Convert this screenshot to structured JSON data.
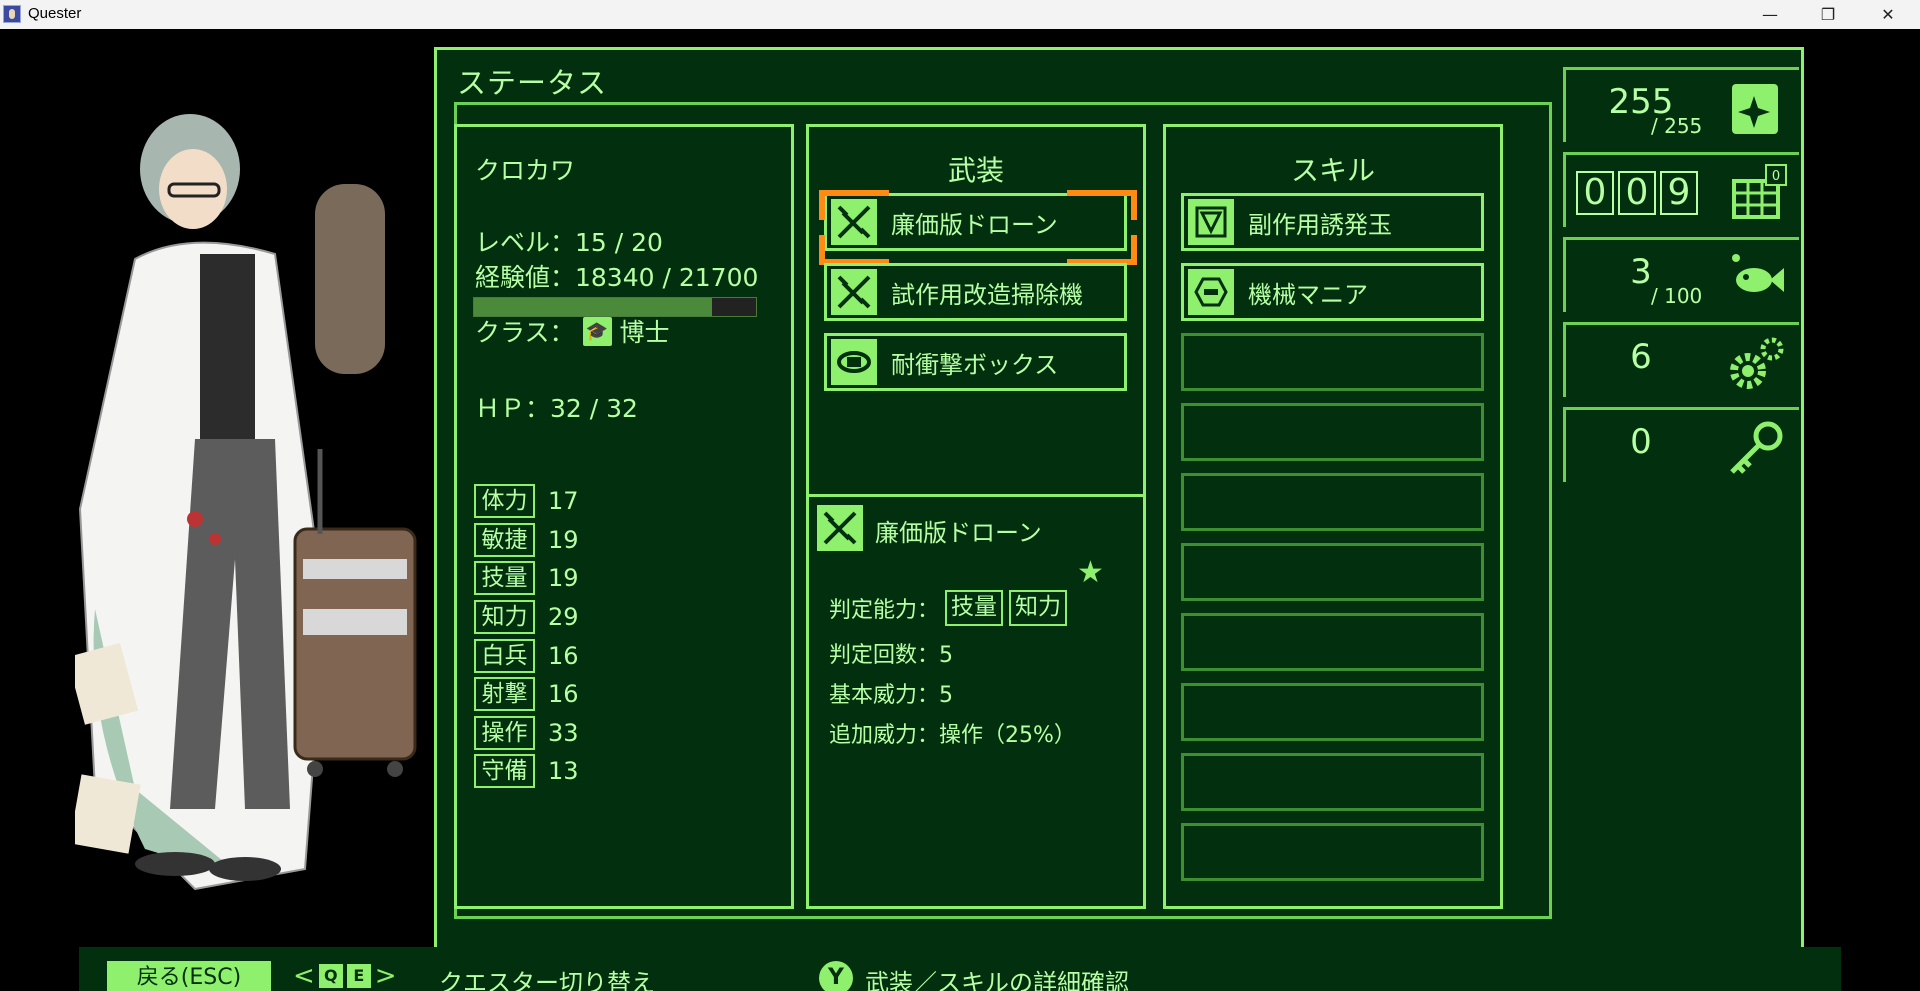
{
  "window": {
    "title": "Quester",
    "minimize": "—",
    "maximize": "❐",
    "close": "✕"
  },
  "panel": {
    "title": "ステータス"
  },
  "character": {
    "name": "クロカワ",
    "level_text": "レベル：15 / 20",
    "exp_text": "経験値：18340 / 21700",
    "exp_fraction": 0.845,
    "class_text": "クラス：",
    "class_name": "博士",
    "hp_text": "ＨＰ：32 / 32",
    "stats": [
      {
        "label": "体力",
        "value": "17"
      },
      {
        "label": "敏捷",
        "value": "19"
      },
      {
        "label": "技量",
        "value": "19"
      },
      {
        "label": "知力",
        "value": "29"
      },
      {
        "label": "白兵",
        "value": "16"
      },
      {
        "label": "射撃",
        "value": "16"
      },
      {
        "label": "操作",
        "value": "33"
      },
      {
        "label": "守備",
        "value": "13"
      }
    ]
  },
  "equipment": {
    "title": "武装",
    "items": [
      {
        "label": "廉価版ドローン",
        "icon": "drone-icon"
      },
      {
        "label": "試作用改造掃除機",
        "icon": "drone-icon"
      },
      {
        "label": "耐衝撃ボックス",
        "icon": "box-icon"
      }
    ],
    "detail": {
      "name": "廉価版ドローン",
      "star": "★",
      "judge_label": "判定能力：",
      "judge_tags": [
        "技量",
        "知力"
      ],
      "count_text": "判定回数：5",
      "power_text": "基本威力：5",
      "extra_text": "追加威力：操作（25%）"
    }
  },
  "skills": {
    "title": "スキル",
    "items": [
      {
        "label": "副作用誘発玉",
        "icon": "skill-ball-icon"
      },
      {
        "label": "機械マニア",
        "icon": "skill-gear-icon"
      }
    ],
    "empty_slots": 8
  },
  "counters": {
    "sparkle": {
      "value": "255",
      "max": "/ 255"
    },
    "odometer": {
      "digits": [
        "0",
        "0",
        "9"
      ],
      "badge": "0"
    },
    "fish": {
      "value": "3",
      "max": "/ 100"
    },
    "gears": {
      "value": "6"
    },
    "keys": {
      "value": "0"
    }
  },
  "help": {
    "back": "戻る(ESC)",
    "q_key": "Q",
    "e_key": "E",
    "switch": "クエスター切り替え",
    "y_key": "Y",
    "detail": "武装／スキルの詳細確認"
  },
  "colors": {
    "panel_bg": "#02300f",
    "accent": "#8ff06e",
    "text": "#b7ffa4",
    "selection": "#ff8a14"
  }
}
